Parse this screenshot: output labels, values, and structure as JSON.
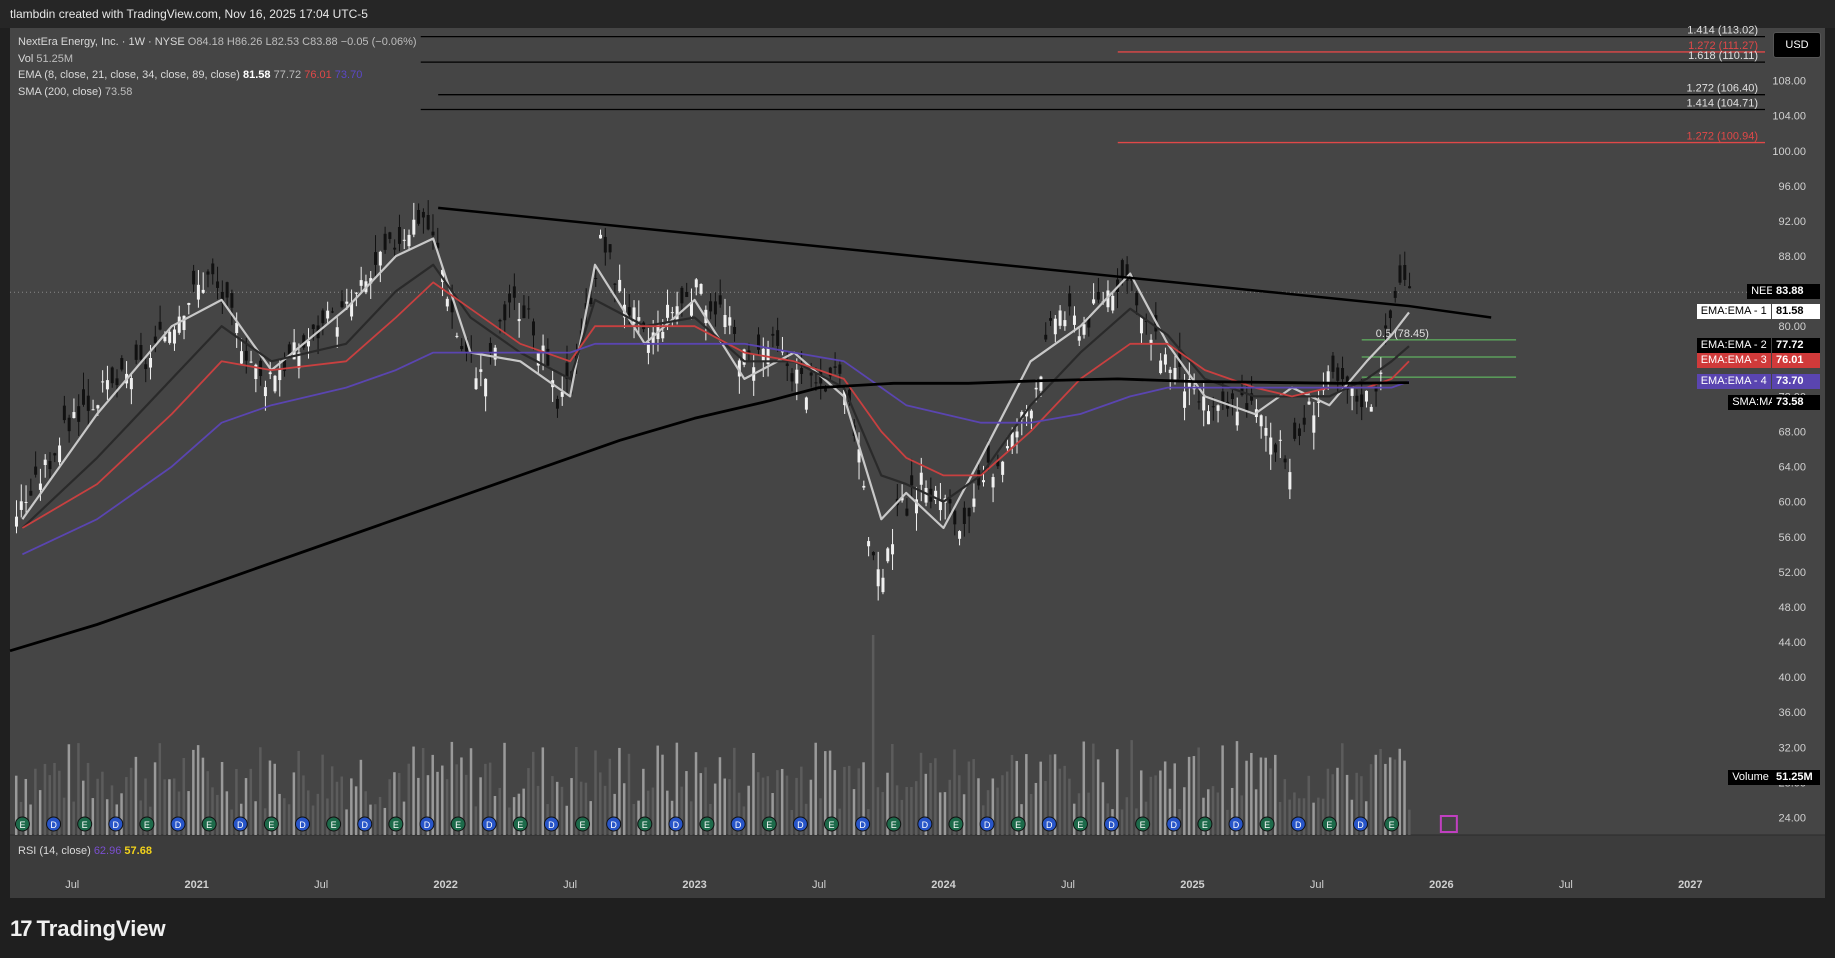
{
  "header": {
    "caption": "tlambdin created with TradingView.com, Nov 16, 2025 17:04 UTC-5"
  },
  "legend": {
    "symbol_line": "NextEra Energy, Inc. · 1W · NYSE",
    "o_label": "O",
    "o_value": "84.18",
    "h_label": "H",
    "h_value": "86.26",
    "l_label": "L",
    "l_value": "82.53",
    "c_label": "C",
    "c_value": "83.88",
    "change": "−0.05 (−0.06%)",
    "vol_label": "Vol",
    "vol_value": "51.25M",
    "ema_label": "EMA (8, close, 21, close, 34, close, 89, close)",
    "ema_v1": "81.58",
    "ema_v2": "77.72",
    "ema_v3": "76.01",
    "ema_v4": "73.70",
    "sma_label": "SMA (200, close)",
    "sma_value": "73.58"
  },
  "rsi": {
    "label": "RSI (14, close)",
    "v1": "62.96",
    "v2": "57.68"
  },
  "currency_button": "USD",
  "footer": {
    "brand": "TradingView"
  },
  "price_tags": [
    {
      "label": "NEE",
      "value": "83.88"
    },
    {
      "label": "EMA:EMA - 1",
      "value": "81.58"
    },
    {
      "label": "EMA:EMA - 2",
      "value": "77.72"
    },
    {
      "label": "EMA:EMA - 3",
      "value": "76.01"
    },
    {
      "label": "EMA:EMA - 4",
      "value": "73.70"
    },
    {
      "label": "SMA:MA",
      "value": "73.58"
    },
    {
      "label": "Volume",
      "value": "51.25M"
    }
  ],
  "colors": {
    "background": "#454545",
    "ema1": "#c8c8c8",
    "ema2": "#2a2a2a",
    "ema3": "#c84040",
    "ema4": "#5a45b0",
    "sma": "#000000",
    "fib": "#66cc66"
  },
  "chart_data": {
    "type": "line",
    "title": "",
    "x_ticks": [
      "Jul",
      "2021",
      "Jul",
      "2022",
      "Jul",
      "2023",
      "Jul",
      "2024",
      "Jul",
      "2025",
      "Jul",
      "2026",
      "Jul",
      "2027"
    ],
    "y_ticks": [
      24,
      28,
      32,
      36,
      40,
      44,
      48,
      52,
      56,
      60,
      64,
      68,
      72,
      76,
      80,
      84,
      88,
      92,
      96,
      100,
      104,
      108
    ],
    "ylim": [
      22,
      114
    ],
    "x_unit": "years",
    "x_range": [
      2020.25,
      2027.3
    ],
    "series": [
      {
        "name": "EMA 8",
        "x": [
          2020.3,
          2020.6,
          2020.9,
          2021.1,
          2021.3,
          2021.6,
          2021.8,
          2021.95,
          2022.1,
          2022.3,
          2022.5,
          2022.6,
          2022.8,
          2023.0,
          2023.2,
          2023.4,
          2023.6,
          2023.75,
          2023.85,
          2024.0,
          2024.15,
          2024.35,
          2024.55,
          2024.75,
          2024.9,
          2025.05,
          2025.25,
          2025.4,
          2025.55,
          2025.7,
          2025.8,
          2025.87
        ],
        "values": [
          58,
          70,
          80,
          83,
          75,
          82,
          88,
          90,
          77,
          76,
          72,
          87,
          78,
          83,
          74,
          77,
          72,
          58,
          61,
          57,
          65,
          76,
          80,
          86,
          78,
          72,
          70,
          73,
          71,
          76,
          79,
          81.58
        ]
      },
      {
        "name": "EMA 21",
        "x": [
          2020.3,
          2020.6,
          2020.9,
          2021.1,
          2021.3,
          2021.6,
          2021.8,
          2021.95,
          2022.1,
          2022.3,
          2022.5,
          2022.6,
          2022.8,
          2023.0,
          2023.2,
          2023.4,
          2023.6,
          2023.75,
          2023.85,
          2024.0,
          2024.15,
          2024.35,
          2024.55,
          2024.75,
          2024.9,
          2025.05,
          2025.25,
          2025.4,
          2025.55,
          2025.7,
          2025.8,
          2025.87
        ],
        "values": [
          57,
          65,
          74,
          80,
          76,
          78,
          84,
          87,
          81,
          77,
          74,
          83,
          80,
          81,
          76,
          76,
          73,
          63,
          62,
          60,
          63,
          71,
          77,
          82,
          79,
          74,
          72,
          72,
          72,
          74,
          76,
          77.72
        ]
      },
      {
        "name": "EMA 34",
        "x": [
          2020.3,
          2020.6,
          2020.9,
          2021.1,
          2021.3,
          2021.6,
          2021.8,
          2021.95,
          2022.1,
          2022.3,
          2022.5,
          2022.6,
          2022.8,
          2023.0,
          2023.2,
          2023.4,
          2023.6,
          2023.75,
          2023.85,
          2024.0,
          2024.15,
          2024.35,
          2024.55,
          2024.75,
          2024.9,
          2025.05,
          2025.25,
          2025.4,
          2025.55,
          2025.7,
          2025.8,
          2025.87
        ],
        "values": [
          57,
          62,
          70,
          76,
          75,
          76,
          81,
          85,
          82,
          78,
          76,
          80,
          80,
          80,
          77,
          76,
          74,
          68,
          65,
          63,
          63,
          68,
          74,
          78,
          78,
          75,
          73,
          72,
          73,
          73,
          74,
          76.01
        ]
      },
      {
        "name": "EMA 89",
        "x": [
          2020.3,
          2020.6,
          2020.9,
          2021.1,
          2021.3,
          2021.6,
          2021.8,
          2021.95,
          2022.1,
          2022.3,
          2022.5,
          2022.6,
          2022.8,
          2023.0,
          2023.2,
          2023.4,
          2023.6,
          2023.75,
          2023.85,
          2024.0,
          2024.15,
          2024.35,
          2024.55,
          2024.75,
          2024.9,
          2025.05,
          2025.25,
          2025.4,
          2025.55,
          2025.7,
          2025.8,
          2025.87
        ],
        "values": [
          54,
          58,
          64,
          69,
          71,
          73,
          75,
          77,
          77,
          77,
          77,
          78,
          78,
          78,
          78,
          77,
          76,
          73,
          71,
          70,
          69,
          69,
          70,
          72,
          73,
          73,
          73,
          73,
          73,
          73,
          73,
          73.7
        ]
      },
      {
        "name": "SMA 200",
        "x": [
          2020.25,
          2020.6,
          2020.9,
          2021.2,
          2021.5,
          2021.8,
          2022.1,
          2022.4,
          2022.7,
          2023.0,
          2023.3,
          2023.5,
          2023.8,
          2024.1,
          2024.4,
          2024.7,
          2025.0,
          2025.3,
          2025.6,
          2025.87
        ],
        "values": [
          43,
          46,
          49,
          52,
          55,
          58,
          61,
          64,
          67,
          69.5,
          71.5,
          73,
          73.5,
          73.5,
          73.8,
          74,
          73.7,
          73.6,
          73.5,
          73.58
        ]
      }
    ],
    "price": {
      "x": [
        2020.25,
        2020.35,
        2020.5,
        2020.65,
        2020.8,
        2020.95,
        2021.05,
        2021.15,
        2021.25,
        2021.35,
        2021.5,
        2021.6,
        2021.7,
        2021.8,
        2021.9,
        2021.97,
        2022.05,
        2022.15,
        2022.25,
        2022.35,
        2022.45,
        2022.55,
        2022.62,
        2022.7,
        2022.8,
        2022.9,
        2023.0,
        2023.1,
        2023.2,
        2023.3,
        2023.45,
        2023.55,
        2023.62,
        2023.7,
        2023.75,
        2023.8,
        2023.9,
        2024.0,
        2024.08,
        2024.15,
        2024.25,
        2024.35,
        2024.45,
        2024.55,
        2024.65,
        2024.72,
        2024.8,
        2024.9,
        2025.0,
        2025.1,
        2025.2,
        2025.3,
        2025.38,
        2025.45,
        2025.55,
        2025.65,
        2025.72,
        2025.78,
        2025.83,
        2025.87
      ],
      "values": [
        58,
        62,
        70,
        73,
        76,
        83,
        86,
        80,
        74,
        76,
        80,
        82,
        86,
        90,
        93,
        88,
        78,
        74,
        83,
        80,
        70,
        80,
        90,
        84,
        78,
        82,
        84,
        82,
        76,
        78,
        73,
        74,
        72,
        55,
        50,
        58,
        62,
        60,
        56,
        62,
        66,
        72,
        82,
        80,
        84,
        86,
        80,
        76,
        72,
        70,
        72,
        68,
        64,
        70,
        74,
        72,
        72,
        80,
        86,
        83.88
      ]
    },
    "trendline": {
      "x": [
        2021.97,
        2025.87,
        2026.2
      ],
      "values": [
        93.5,
        82.3,
        81
      ]
    },
    "fib_levels": [
      {
        "label": "1.414 (113.02)",
        "value": 113.02
      },
      {
        "label": "1.272 (111.27)",
        "value": 111.27
      },
      {
        "label": "1.618 (110.11)",
        "value": 110.11
      },
      {
        "label": "1.272 (106.40)",
        "value": 106.4
      },
      {
        "label": "1.414 (104.71)",
        "value": 104.71
      },
      {
        "label": "1.272 (100.94)",
        "value": 100.94
      },
      {
        "label": "0.5 (78.45)",
        "value": 78.45
      }
    ],
    "volume_spike_date": 2023.72
  }
}
